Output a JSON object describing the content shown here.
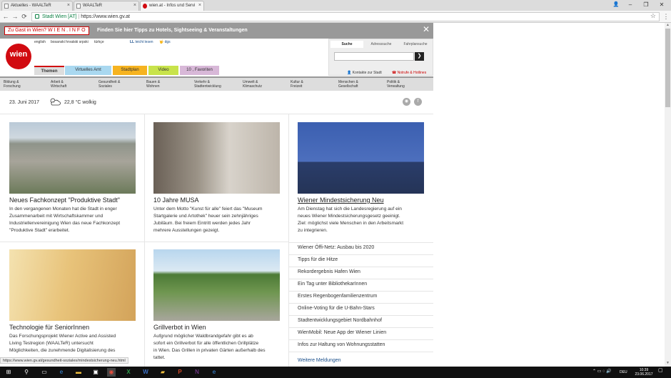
{
  "browser": {
    "tabs": [
      {
        "title": "Aktuelles - WAALTeR"
      },
      {
        "title": "WAALTeR"
      },
      {
        "title": "wien.at - Infos und Servi"
      }
    ],
    "secure_label": "Stadt Wien [AT]",
    "url": "https://www.wien.gv.at",
    "status_url": "https://www.wien.gv.at/gesundheit-soziales/mindestsicherung-neu.html"
  },
  "banner": {
    "logo_label": "Zu Gast in Wien? W I E N . I N F O",
    "text": "Finden Sie hier Tipps zu Hotels, Sightseeing & Veranstaltungen",
    "close": "✕"
  },
  "header": {
    "logo_text": "wien",
    "languages": [
      "english",
      "bosanski hrvatski srpski",
      "türkçe"
    ],
    "leicht_lesen": "leicht lesen",
    "dgs": "dgs",
    "search_tabs": [
      "Suche",
      "Adresssuche",
      "Fahrplansuche"
    ],
    "search_go": "❯",
    "nav_tabs": [
      {
        "label": "Themen",
        "color": "#dddddd"
      },
      {
        "label": "Virtuelles Amt",
        "color": "#a9d8f0"
      },
      {
        "label": "Stadtplan",
        "color": "#f6b320"
      },
      {
        "label": "Video",
        "color": "#c8e34b"
      },
      {
        "label": "10 , Favoriten",
        "color": "#d8b8d8"
      }
    ],
    "kontakte": "Kontakte zur Stadt",
    "notrufe": "Notrufe & Hotlines"
  },
  "categories": [
    [
      "Bildung &",
      "Forschung"
    ],
    [
      "Arbeit &",
      "Wirtschaft"
    ],
    [
      "Gesundheit &",
      "Soziales"
    ],
    [
      "Bauen &",
      "Wohnen"
    ],
    [
      "Verkehr &",
      "Stadtentwicklung"
    ],
    [
      "Umwelt &",
      "Klimaschutz"
    ],
    [
      "Kultur &",
      "Freizeit"
    ],
    [
      "Menschen &",
      "Gesellschaft"
    ],
    [
      "Politik &",
      "Verwaltung"
    ]
  ],
  "weather": {
    "date": "23. Juni 2017",
    "temp": "22,8 °C wolkig"
  },
  "articles": [
    {
      "title": "Neues Fachkonzept \"Produktive Stadt\"",
      "lines": [
        "In den vergangenen Monaten hat die Stadt in enger",
        "Zusammenarbeit mit Wirtschaftskammer und",
        "Industriellenvereinigung Wien das neue Fachkonzept",
        "\"Produktive Stadt\" erarbeitet."
      ]
    },
    {
      "title": "10 Jahre MUSA",
      "lines": [
        "Unter dem Motto \"Kunst für alle\" feiert das \"Museum",
        "Startgalerie und Artothek\" heuer sein zehnjähriges",
        "Jubiläum. Bei freiem Eintritt werden jedes Jahr",
        "mehrere Ausstellungen gezeigt."
      ]
    },
    {
      "title": "Wiener Mindestsicherung Neu",
      "lines": [
        "Am Dienstag hat sich die Landesregierung auf ein",
        "neues Wiener Mindestsicherungsgesetz geeinigt.",
        "Ziel: möglichst viele Menschen in den Arbeitsmarkt",
        "zu integrieren."
      ]
    },
    {
      "title": "Technologie für SeniorInnen",
      "lines": [
        "Das Forschungsprojekt Wiener Active and Assisted",
        "Living Testregion (WAALTeR) untersucht",
        "Möglichkeiten, die zunehmende Digitalisierung des"
      ]
    },
    {
      "title": "Grillverbot in Wien",
      "lines": [
        "Aufgrund möglicher Waldbrandgefahr gibt es ab",
        "sofort ein Grillverbot für alle öffentlichen Grillplätze",
        "in Wien. Das Grillen in privaten Gärten außerhalb des",
        "tattet."
      ]
    }
  ],
  "links": [
    "Wiener Öffi-Netz: Ausbau bis 2020",
    "Tipps für die Hitze",
    "Rekordergebnis Hafen Wien",
    "Ein Tag unter BibliothekarInnen",
    "Erstes Regenbogenfamilienzentrum",
    "Online-Voting für die U-Bahn-Stars",
    "Stadtentwicklungsgebiet Nordbahnhof",
    "WienMobil: Neue App der Wiener Linien",
    "Infos zur Haltung von Wohnungsstatten"
  ],
  "more_link": "Weitere Meldungen",
  "taskbar": {
    "lang": "DEU",
    "time": "10:39",
    "date": "23.06.2017"
  }
}
